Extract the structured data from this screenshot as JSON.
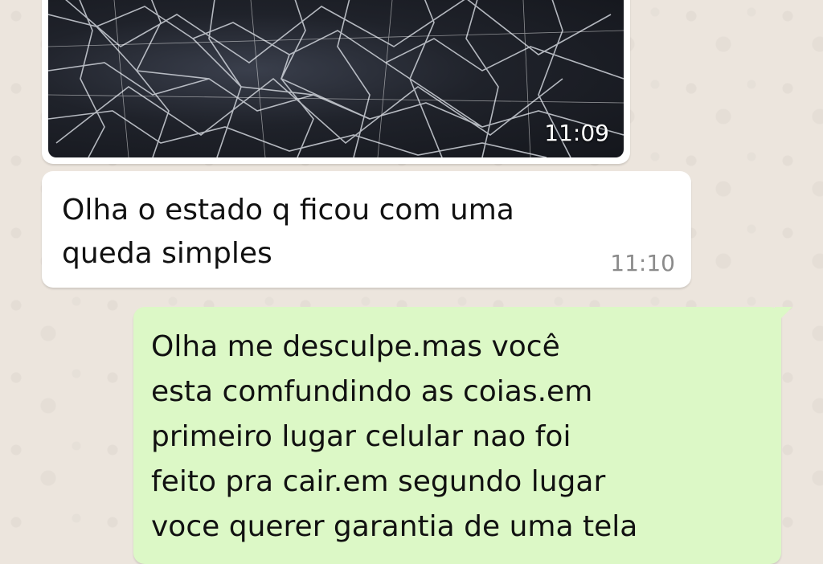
{
  "chat": {
    "messages": [
      {
        "direction": "incoming",
        "kind": "image",
        "image_description_icon": "cracked-screen-photo",
        "time": "11:09"
      },
      {
        "direction": "incoming",
        "kind": "text",
        "text": "Olha o estado q ficou com uma\nqueda simples",
        "time": "11:10"
      },
      {
        "direction": "outgoing",
        "kind": "text",
        "text": "Olha me desculpe.mas você\nesta comfundindo as coias.em\nprimeiro lugar celular nao foi\nfeito pra cair.em segundo lugar\nvoce querer garantia de uma tela"
      }
    ]
  },
  "colors": {
    "background": "#ece5dd",
    "incoming_bubble": "#ffffff",
    "outgoing_bubble": "#dcf8c6",
    "time_text": "#8b8b8b"
  }
}
